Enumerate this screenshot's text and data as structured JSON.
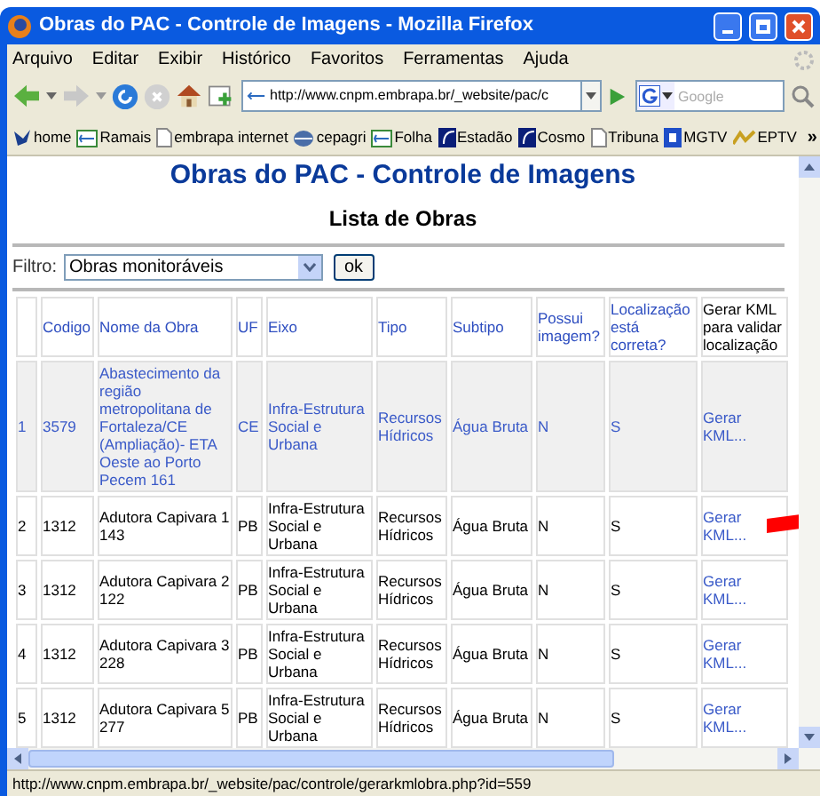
{
  "window": {
    "title": "Obras do PAC - Controle de Imagens - Mozilla Firefox"
  },
  "menu": [
    "Arquivo",
    "Editar",
    "Exibir",
    "Histórico",
    "Favoritos",
    "Ferramentas",
    "Ajuda"
  ],
  "address": {
    "value": "http://www.cnpm.embrapa.br/_website/pac/c"
  },
  "search": {
    "placeholder": "Google"
  },
  "bookmarks": [
    {
      "label": "home"
    },
    {
      "label": "Ramais"
    },
    {
      "label": "embrapa internet"
    },
    {
      "label": "cepagri"
    },
    {
      "label": "Folha"
    },
    {
      "label": "Estadão"
    },
    {
      "label": "Cosmo"
    },
    {
      "label": "Tribuna"
    },
    {
      "label": "MGTV"
    },
    {
      "label": "EPTV"
    }
  ],
  "bookmarks_more": "»",
  "page": {
    "title": "Obras do PAC - Controle de Imagens",
    "subtitle": "Lista de Obras",
    "filter_label": "Filtro:",
    "filter_value": "Obras monitoráveis",
    "filter_button": "ok"
  },
  "table": {
    "columns": [
      {
        "kind": "plain"
      },
      {
        "label": "Codigo",
        "kind": "link"
      },
      {
        "label": "Nome da Obra",
        "kind": "link"
      },
      {
        "label": "UF",
        "kind": "link"
      },
      {
        "label": "Eixo",
        "kind": "link"
      },
      {
        "label": "Tipo",
        "kind": "link"
      },
      {
        "label": "Subtipo",
        "kind": "link"
      },
      {
        "label": "Possui imagem?",
        "kind": "link"
      },
      {
        "label": "Localização está correta?",
        "kind": "link"
      },
      {
        "label": "Gerar KML para validar localização",
        "kind": "plain"
      }
    ],
    "rows": [
      {
        "selected": true,
        "cells": [
          "1",
          "3579",
          "Abastecimento da região metropolitana de Fortaleza/CE (Ampliação)- ETA Oeste ao Porto Pecem 161",
          "CE",
          "Infra-Estrutura Social e Urbana",
          "Recursos Hídricos",
          "Água Bruta",
          "N",
          "S",
          "Gerar KML..."
        ]
      },
      {
        "selected": false,
        "cells": [
          "2",
          "1312",
          "Adutora Capivara 1 143",
          "PB",
          "Infra-Estrutura Social e Urbana",
          "Recursos Hídricos",
          "Água Bruta",
          "N",
          "S",
          "Gerar KML..."
        ]
      },
      {
        "selected": false,
        "cells": [
          "3",
          "1312",
          "Adutora Capivara 2 122",
          "PB",
          "Infra-Estrutura Social e Urbana",
          "Recursos Hídricos",
          "Água Bruta",
          "N",
          "S",
          "Gerar KML..."
        ]
      },
      {
        "selected": false,
        "cells": [
          "4",
          "1312",
          "Adutora Capivara 3 228",
          "PB",
          "Infra-Estrutura Social e Urbana",
          "Recursos Hídricos",
          "Água Bruta",
          "N",
          "S",
          "Gerar KML..."
        ]
      },
      {
        "selected": false,
        "cells": [
          "5",
          "1312",
          "Adutora Capivara 5 277",
          "PB",
          "Infra-Estrutura Social e Urbana",
          "Recursos Hídricos",
          "Água Bruta",
          "N",
          "S",
          "Gerar KML..."
        ]
      }
    ]
  },
  "status_bar": {
    "text": "http://www.cnpm.embrapa.br/_website/pac/controle/gerarkmlobra.php?id=559"
  }
}
